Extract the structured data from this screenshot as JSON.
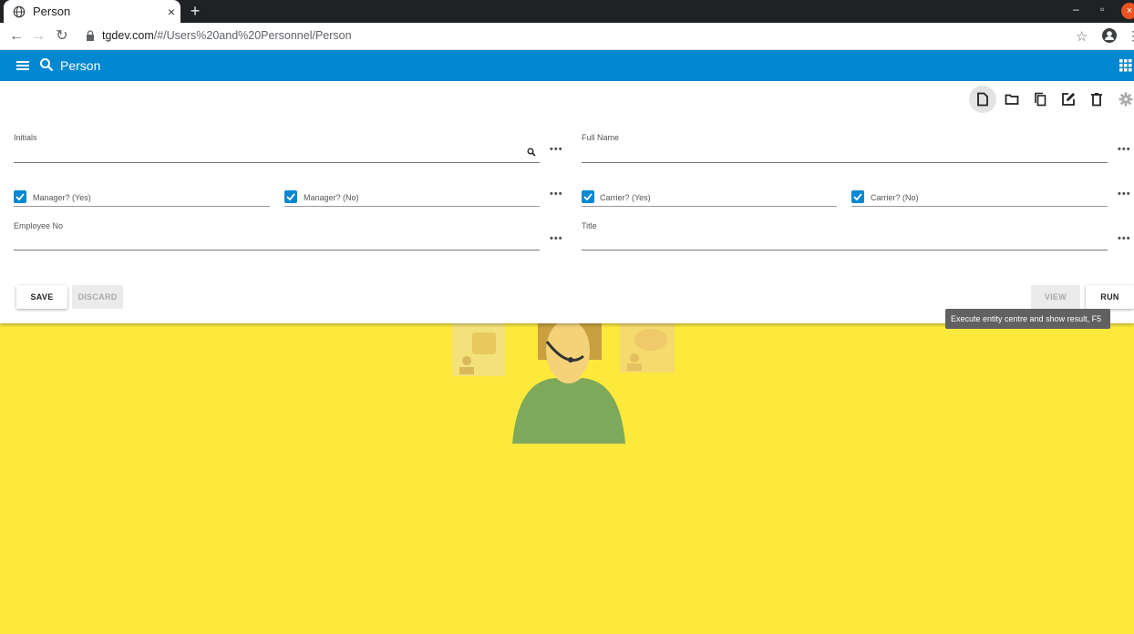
{
  "browser": {
    "tab_title": "Person",
    "tab_close": "×",
    "new_tab": "+",
    "url_host": "tgdev.com",
    "url_path": "/#/Users%20and%20Personnel/Person",
    "win_minimize": "–",
    "win_restore": "▫",
    "win_close": "×"
  },
  "appbar": {
    "title": "Person"
  },
  "form": {
    "initials_label": "Initials",
    "full_name_label": "Full Name",
    "manager_yes_label": "Manager? (Yes)",
    "manager_no_label": "Manager? (No)",
    "carrier_yes_label": "Carrier? (Yes)",
    "carrier_no_label": "Carrier? (No)",
    "employee_no_label": "Employee No",
    "title_label": "Title",
    "dots": "•••"
  },
  "buttons": {
    "save": "SAVE",
    "discard": "DISCARD",
    "view": "VIEW",
    "run": "RUN"
  },
  "tooltip": {
    "text": "Execute entity centre and show result, F5"
  },
  "colors": {
    "appbar": "#0288d1",
    "background": "#fde93b",
    "checkbox": "#0288d1"
  }
}
